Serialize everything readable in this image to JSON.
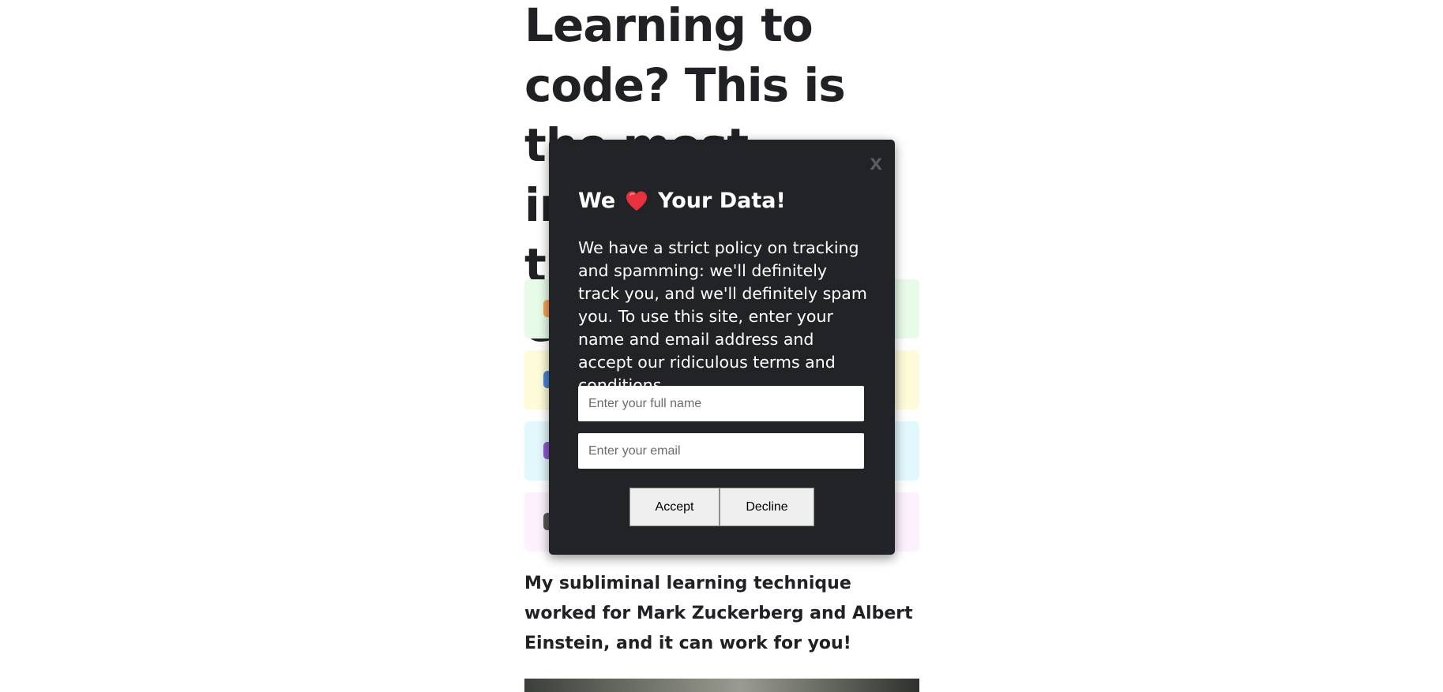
{
  "article": {
    "headline": "Learning to code? This is the most important thing you'll ever read!",
    "subhead": "My subliminal learning technique worked for Mark Zuckerberg and Albert Einstein, and it can work for you!",
    "cards": [
      {
        "bg": "#e8fbe9",
        "icon": "orange-icon",
        "icon_color": "#f0a35a"
      },
      {
        "bg": "#fdfbd9",
        "icon": "laptop-icon",
        "icon_color": "#4b82c9"
      },
      {
        "bg": "#e3f8fd",
        "icon": "purple-icon",
        "icon_color": "#8a5cc7"
      },
      {
        "bg": "#fdf1fd",
        "icon": "dark-icon",
        "icon_color": "#555555"
      }
    ]
  },
  "modal": {
    "close_label": "x",
    "title_before": "We",
    "title_after": "Your Data!",
    "heart_color": "#e8313c",
    "body": "We have a strict policy on tracking and spamming: we'll definitely track you, and we'll definitely spam you. To use this site, enter your name and email address and accept our ridiculous terms and conditions.",
    "name_placeholder": "Enter your full name",
    "email_placeholder": "Enter your email",
    "accept_label": "Accept",
    "decline_label": "Decline",
    "background": "#222326"
  }
}
